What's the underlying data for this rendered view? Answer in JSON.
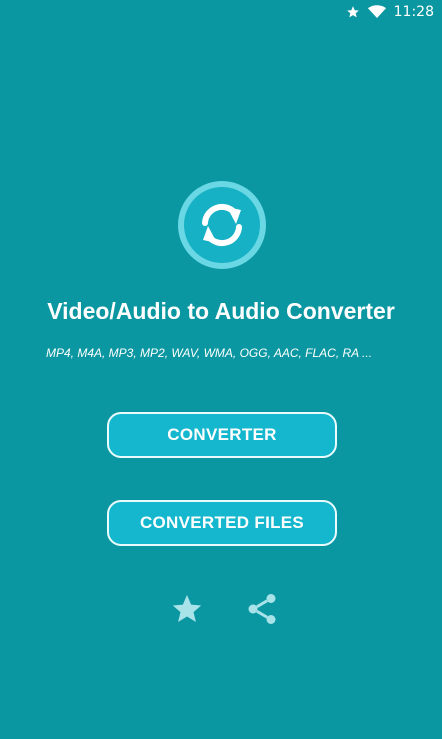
{
  "status_bar": {
    "time": "11:28",
    "icons": [
      "star-icon",
      "wifi-icon"
    ]
  },
  "app": {
    "logo_icon": "convert-arrows-icon",
    "title": "Video/Audio to Audio Converter",
    "formats": "MP4, M4A, MP3, MP2, WAV, WMA, OGG, AAC, FLAC, RA ..."
  },
  "buttons": {
    "converter_label": "CONVERTER",
    "converted_files_label": "CONVERTED FILES"
  },
  "actions": {
    "rate_icon": "star-icon",
    "share_icon": "share-icon"
  },
  "colors": {
    "background": "#0b97a1",
    "button_fill": "#14b7cd",
    "button_border": "#e9fbfd",
    "logo_ring": "#6ad7e4",
    "action_icon": "#a9e3ea"
  }
}
